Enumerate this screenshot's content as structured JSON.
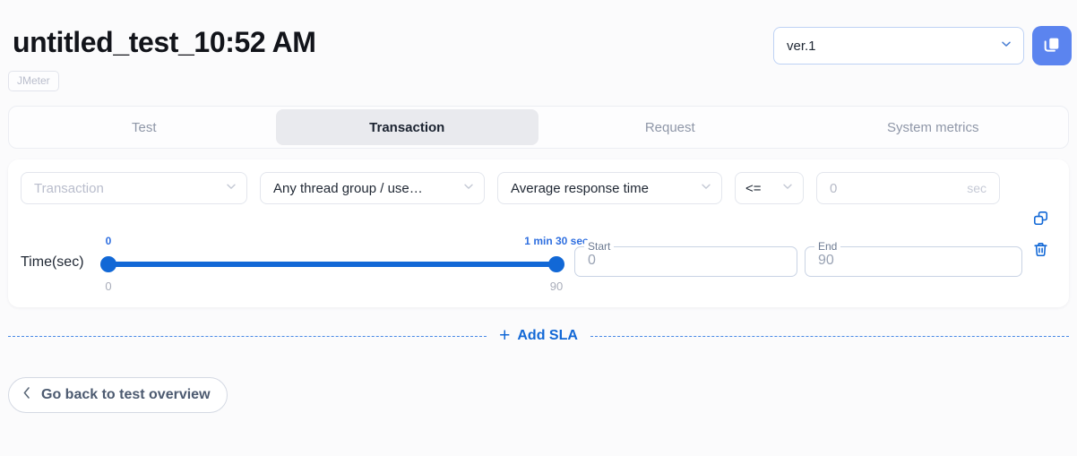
{
  "header": {
    "title": "untitled_test_10:52 AM",
    "badge": "JMeter",
    "version": "ver.1",
    "copy_icon": "copy-icon",
    "chevron_icon": "chevron-down-icon"
  },
  "tabs": [
    {
      "label": "Test",
      "active": false
    },
    {
      "label": "Transaction",
      "active": true
    },
    {
      "label": "Request",
      "active": false
    },
    {
      "label": "System metrics",
      "active": false
    }
  ],
  "sla": {
    "transaction": {
      "value": "Transaction",
      "is_placeholder": true
    },
    "thread_group": {
      "value": "Any thread group / use…"
    },
    "metric": {
      "value": "Average response time"
    },
    "operator": {
      "value": "<="
    },
    "threshold": {
      "value": "0",
      "suffix": "sec"
    },
    "slider": {
      "label": "Time(sec)",
      "start_top": "0",
      "end_top": "1 min 30 sec",
      "start_bottom": "0",
      "end_bottom": "90"
    },
    "start_input": {
      "label": "Start",
      "value": "0"
    },
    "end_input": {
      "label": "End",
      "value": "90"
    },
    "actions": {
      "duplicate_icon": "duplicate-icon",
      "delete_icon": "trash-icon"
    }
  },
  "add_sla": {
    "label": "Add SLA",
    "plus": "+"
  },
  "footer": {
    "back_label": "Go back to test overview",
    "back_icon": "chevron-left-icon"
  },
  "colors": {
    "accent_blue": "#1268d6",
    "button_blue": "#5b84ef",
    "page_bg": "#fbfbfc",
    "active_tab_bg": "#e9eaee"
  }
}
